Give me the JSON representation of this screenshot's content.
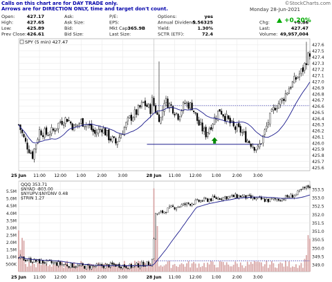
{
  "chart_data": {
    "type": "candlestick",
    "watermark": "©StockCharts.com",
    "notes": [
      "Calls on this chart are for DAY TRADE only.",
      "Arrows are for DIRECTION ONLY, time and target don't count."
    ],
    "header": {
      "date": "Monday 28-Jun-2021",
      "change_pct": "+0.20%",
      "rows": [
        {
          "l1": "Open:",
          "v1": "427.17",
          "l2": "Ask:",
          "v2": "",
          "l3": "P/E:",
          "v3": "",
          "l4": "Options:",
          "v4": "yes",
          "l5": "",
          "v5": ""
        },
        {
          "l1": "High:",
          "v1": "427.65",
          "l2": "Ask Size:",
          "v2": "",
          "l3": "EPS:",
          "v3": "",
          "l4": "Annual Dividend:",
          "v4": "5.56325",
          "l5": "Chg:",
          "v5": "+0.86"
        },
        {
          "l1": "Low:",
          "v1": "425.89",
          "l2": "Bid:",
          "v2": "",
          "l3": "Mkt Cap:",
          "v3": "365.9B",
          "l4": "Yield:",
          "v4": "1.30%",
          "l5": "Last:",
          "v5": "427.47"
        },
        {
          "l1": "Prev Close:",
          "v1": "426.61",
          "l2": "Bid Size:",
          "v2": "",
          "l3": "Last Size:",
          "v3": "",
          "l4": "SCTR (ETF):",
          "v4": "72.4",
          "l5": "Volume:",
          "v5": "49,957,004"
        }
      ]
    },
    "main": {
      "legend": "SPY (5 min) 427.47",
      "ylim": [
        425.55,
        427.7
      ],
      "y_ticks": [
        "427.6",
        "427.5",
        "427.4",
        "427.3",
        "427.2",
        "427.1",
        "427.0",
        "426.9",
        "426.8",
        "426.7",
        "426.6",
        "426.5",
        "426.4",
        "426.3",
        "426.2",
        "426.1",
        "426.0",
        "425.9",
        "425.8",
        "425.7",
        "425.6"
      ],
      "reference_line": 426.61,
      "support_line": 425.98,
      "arrow": "up",
      "anchors": [
        {
          "x": 0,
          "y": 426.3
        },
        {
          "x": 4,
          "y": 426.0
        },
        {
          "x": 8,
          "y": 425.8
        },
        {
          "x": 12,
          "y": 426.2
        },
        {
          "x": 16,
          "y": 426.15
        },
        {
          "x": 20,
          "y": 426.2
        },
        {
          "x": 24,
          "y": 426.35
        },
        {
          "x": 28,
          "y": 426.4
        },
        {
          "x": 32,
          "y": 426.25
        },
        {
          "x": 36,
          "y": 426.35
        },
        {
          "x": 40,
          "y": 426.3
        },
        {
          "x": 44,
          "y": 426.15
        },
        {
          "x": 48,
          "y": 426.25
        },
        {
          "x": 52,
          "y": 426.1
        },
        {
          "x": 56,
          "y": 426.0
        },
        {
          "x": 60,
          "y": 426.2
        },
        {
          "x": 64,
          "y": 426.4
        },
        {
          "x": 68,
          "y": 426.5
        },
        {
          "x": 72,
          "y": 426.65
        },
        {
          "x": 76,
          "y": 426.55
        },
        {
          "x": 77,
          "y": 426.7
        },
        {
          "x": 80,
          "y": 426.45
        },
        {
          "x": 82,
          "y": 426.4
        },
        {
          "x": 84,
          "y": 426.7
        },
        {
          "x": 88,
          "y": 426.6
        },
        {
          "x": 92,
          "y": 426.45
        },
        {
          "x": 96,
          "y": 426.65
        },
        {
          "x": 100,
          "y": 426.6
        },
        {
          "x": 104,
          "y": 426.3
        },
        {
          "x": 108,
          "y": 426.15
        },
        {
          "x": 112,
          "y": 426.35
        },
        {
          "x": 116,
          "y": 426.55
        },
        {
          "x": 120,
          "y": 426.4
        },
        {
          "x": 124,
          "y": 426.25
        },
        {
          "x": 128,
          "y": 426.2
        },
        {
          "x": 132,
          "y": 426.05
        },
        {
          "x": 136,
          "y": 425.95
        },
        {
          "x": 138,
          "y": 425.9
        },
        {
          "x": 141,
          "y": 426.1
        },
        {
          "x": 144,
          "y": 426.35
        },
        {
          "x": 148,
          "y": 426.6
        },
        {
          "x": 152,
          "y": 426.7
        },
        {
          "x": 156,
          "y": 426.9
        },
        {
          "x": 160,
          "y": 427.05
        },
        {
          "x": 164,
          "y": 427.2
        },
        {
          "x": 166,
          "y": 427.35
        },
        {
          "x": 168,
          "y": 427.47
        }
      ],
      "spikes": [
        {
          "i": 81,
          "h": 427.33,
          "l": 426.4
        },
        {
          "i": 166,
          "h": 427.65,
          "l": 427.2
        }
      ]
    },
    "lower": {
      "legends": [
        "QQQ 353.71",
        "$NYAD -803.00",
        "$NYUPV:$NYDNV 0.48",
        "$TRIN 1.27"
      ],
      "ylim_price": [
        348.6,
        354.0
      ],
      "ylim_volume": [
        0,
        6.2
      ],
      "y_ticks_right": [
        "353.5",
        "353.0",
        "352.5",
        "352.0",
        "351.5",
        "351.0",
        "350.5",
        "350.0",
        "349.5",
        "349.0"
      ],
      "y_ticks_left": [
        "5.5M",
        "5.0M",
        "4.5M",
        "4.0M",
        "3.5M",
        "3.0M",
        "2.5M",
        "2.0M",
        "1.5M",
        "1.0M",
        "500K"
      ],
      "dotted_line": 349.25,
      "anchors": [
        {
          "x": 0,
          "y": 349.4
        },
        {
          "x": 8,
          "y": 349.25
        },
        {
          "x": 16,
          "y": 349.15
        },
        {
          "x": 24,
          "y": 349.05
        },
        {
          "x": 32,
          "y": 348.95
        },
        {
          "x": 40,
          "y": 348.9
        },
        {
          "x": 48,
          "y": 348.95
        },
        {
          "x": 56,
          "y": 349.0
        },
        {
          "x": 64,
          "y": 348.9
        },
        {
          "x": 72,
          "y": 349.05
        },
        {
          "x": 76,
          "y": 349.1
        },
        {
          "x": 77,
          "y": 349.3
        },
        {
          "x": 79,
          "y": 352.0
        },
        {
          "x": 82,
          "y": 352.1
        },
        {
          "x": 88,
          "y": 352.4
        },
        {
          "x": 96,
          "y": 352.6
        },
        {
          "x": 104,
          "y": 352.8
        },
        {
          "x": 112,
          "y": 352.95
        },
        {
          "x": 120,
          "y": 353.05
        },
        {
          "x": 128,
          "y": 353.1
        },
        {
          "x": 136,
          "y": 352.95
        },
        {
          "x": 144,
          "y": 352.85
        },
        {
          "x": 152,
          "y": 352.95
        },
        {
          "x": 160,
          "y": 353.2
        },
        {
          "x": 164,
          "y": 353.5
        },
        {
          "x": 168,
          "y": 353.71
        }
      ]
    },
    "x_labels": [
      "25 Jun",
      "11:00",
      "12:00",
      "1:00",
      "2:00",
      "3:00",
      "28 Jun",
      "11:00",
      "12:00",
      "1:00",
      "2:00",
      "3:00"
    ],
    "x_label_indices": [
      0,
      12,
      24,
      36,
      48,
      60,
      78,
      90,
      102,
      114,
      126,
      138
    ],
    "bars": 169,
    "day_break": 78,
    "colors": {
      "up": "#000000",
      "down": "#000000",
      "ma": "#1a1a8c",
      "volume": "#d9a8a8",
      "ref": "#2222aa",
      "support": "#000080",
      "arrow": "#008800",
      "title": "#0000aa",
      "pos": "#00aa00",
      "grid": "#e6e6e6"
    }
  }
}
